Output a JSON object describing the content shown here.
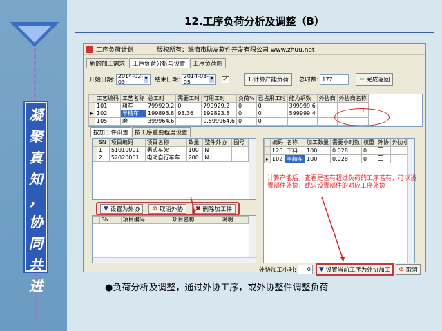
{
  "slide": {
    "title": "12.工序负荷分析及调整（B）",
    "slogan_chars": [
      "凝",
      "聚",
      "真",
      "知",
      "，",
      "协",
      "同",
      "共",
      "进"
    ],
    "bullet": "●负荷分析及调整，通过外协工序，或外协整件调整负荷"
  },
  "window": {
    "title": "工序负荷计划",
    "copyright": "版权所有：珠海市助友软件开发有限公司 www.zhuu.net",
    "tabs": [
      "新的加工需求",
      "工序负荷分析与设置",
      "工序负荷图"
    ],
    "active_tab_index": 1,
    "toolbar": {
      "start_label": "开始日期:",
      "start_date": "2014-02-03",
      "end_label": "结束日期:",
      "end_date": "2014-03-05",
      "calc_button": "1.计算产能负荷",
      "total_label": "总时数:",
      "total_value": "177",
      "complete_button": "完成返回"
    },
    "grid1": {
      "headers": [
        "工艺编码",
        "工艺名称",
        "总工时",
        "需要工时",
        "可用工时",
        "负荷%",
        "已占用工时",
        "能力系数",
        "外协商",
        "外协商名称"
      ],
      "rows": [
        [
          "101",
          "粗车",
          "799929.2",
          "0",
          "799929.2",
          "0",
          "0",
          "399999.6",
          "",
          ""
        ],
        [
          "102",
          "半精车",
          "199893.8",
          "93.36",
          "199893.8",
          "0",
          "0",
          "599999.4",
          "",
          ""
        ],
        [
          "105",
          "磨",
          "399964.6",
          "",
          "0.599964.6",
          "0",
          "0",
          "",
          "",
          ""
        ]
      ],
      "selected_row": 1
    },
    "subtabs": [
      "按加工件设置",
      "按工序重要程度设置"
    ],
    "active_subtab": 0,
    "left_table": {
      "headers": [
        "SN",
        "项目编码",
        "项目名称",
        "数量",
        "整件外协",
        "图号"
      ],
      "rows": [
        [
          "1",
          "51010001",
          "男式车架",
          "100",
          "N",
          ""
        ],
        [
          "2",
          "52020001",
          "电动自行车车",
          "200",
          "N",
          ""
        ]
      ]
    },
    "right_table": {
      "headers": [
        "编码",
        "名称",
        "加工数量",
        "需要小时数",
        "权重",
        "外协",
        "外协小"
      ],
      "rows": [
        [
          "126",
          "下料",
          "100",
          "0.028",
          "0",
          "",
          ""
        ],
        [
          "102",
          "半精车",
          "100",
          "0.028",
          "0",
          "",
          ""
        ]
      ]
    },
    "action_buttons": {
      "set_outsource": "设置为外协",
      "cancel_outsource": "取消外协",
      "delete_part": "删除加工件"
    },
    "left_table2": {
      "headers": [
        "SN",
        "项目编码",
        "项目名称",
        "说明"
      ]
    },
    "annotation": "计算产能后，查看是否有超过负荷的工序若有，可以设置部件外协，或只设置部件的对应工序外协",
    "bottom": {
      "label": "外协加工小时:",
      "value": "0",
      "set_button": "设置当前工序为外协加工",
      "cancel_button": "取消"
    },
    "marker_number": "1"
  },
  "colors": {
    "accent_red": "#d22222",
    "selection_blue": "#3169c6",
    "slogan_bg": "#2d5bb5"
  }
}
